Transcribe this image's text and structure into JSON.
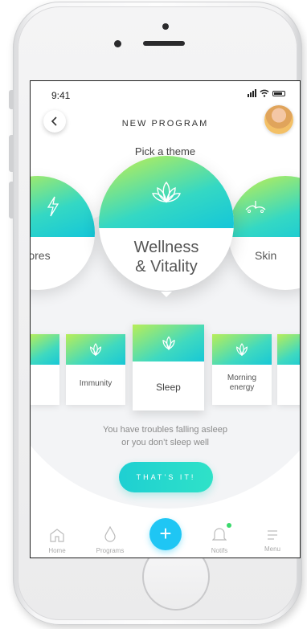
{
  "status": {
    "time": "9:41"
  },
  "header": {
    "title": "NEW PROGRAM",
    "subtitle": "Pick a theme"
  },
  "themes": {
    "left": "Sores",
    "center_line1": "Wellness",
    "center_line2": "& Vitality",
    "right": "Skin"
  },
  "cards": [
    {
      "label": "Immunity"
    },
    {
      "label": "Sleep",
      "selected": true
    },
    {
      "label_line1": "Morning",
      "label_line2": "energy"
    }
  ],
  "description": {
    "line1": "You have troubles falling asleep",
    "line2": "or you don’t sleep well"
  },
  "cta": {
    "label": "THAT’S IT!"
  },
  "tabbar": {
    "home": "Home",
    "programs": "Programs",
    "plus": "+",
    "notifs": "Notifs",
    "menu": "Menu"
  },
  "colors": {
    "accent": "#1fc6f4",
    "gradient_start": "#c7f04c",
    "gradient_end": "#14c6d9",
    "notif": "#3ad96c"
  },
  "icons": [
    "back-chevron-icon",
    "lightning-icon",
    "lotus-icon",
    "skin-icon",
    "home-icon",
    "drop-icon",
    "plus-icon",
    "bell-icon",
    "menu-icon"
  ]
}
